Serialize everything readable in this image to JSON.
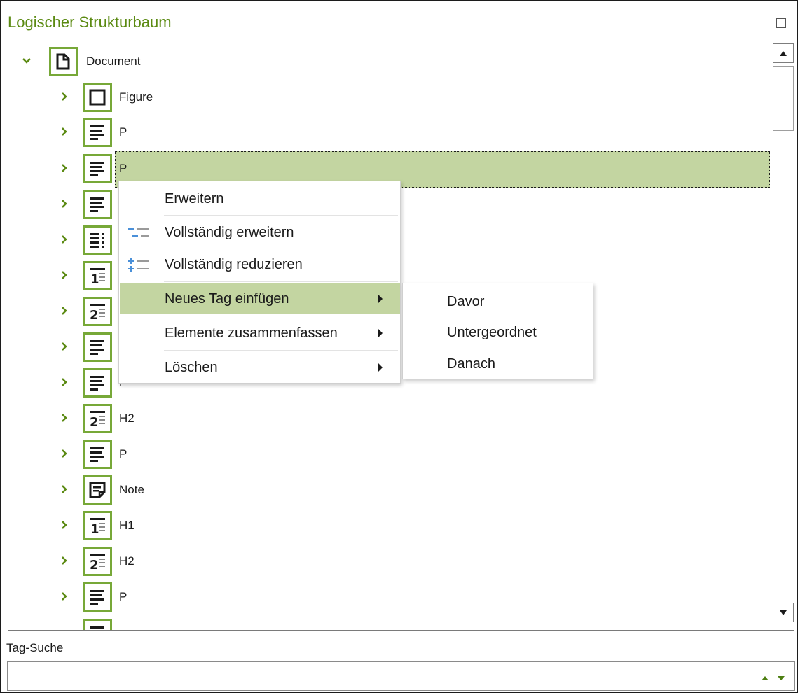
{
  "panel": {
    "title": "Logischer Strukturbaum"
  },
  "tree": {
    "root": {
      "label": "Document",
      "icon": "document-icon"
    },
    "rows": [
      {
        "label": "Figure",
        "icon": "figure-icon"
      },
      {
        "label": "P",
        "icon": "paragraph-icon"
      },
      {
        "label": "P",
        "icon": "paragraph-icon",
        "selected": true
      },
      {
        "label": "",
        "icon": "paragraph-icon"
      },
      {
        "label": "",
        "icon": "list-icon"
      },
      {
        "label": "",
        "icon": "heading-1-icon"
      },
      {
        "label": "",
        "icon": "heading-2-icon"
      },
      {
        "label": "",
        "icon": "paragraph-icon"
      },
      {
        "label": "P",
        "icon": "paragraph-icon"
      },
      {
        "label": "H2",
        "icon": "heading-2-icon"
      },
      {
        "label": "P",
        "icon": "paragraph-icon"
      },
      {
        "label": "Note",
        "icon": "note-icon"
      },
      {
        "label": "H1",
        "icon": "heading-1-icon"
      },
      {
        "label": "H2",
        "icon": "heading-2-icon"
      },
      {
        "label": "P",
        "icon": "paragraph-icon"
      },
      {
        "label": "",
        "icon": "paragraph-icon"
      }
    ]
  },
  "context_menu": {
    "items": [
      {
        "label": "Erweitern"
      },
      {
        "label": "Vollständig erweitern",
        "icon": "expand-all-icon"
      },
      {
        "label": "Vollständig reduzieren",
        "icon": "collapse-all-icon"
      },
      {
        "label": "Neues Tag einfügen",
        "submenu": true,
        "highlighted": true
      },
      {
        "label": "Elemente zusammenfassen",
        "submenu": true
      },
      {
        "label": "Löschen",
        "submenu": true
      }
    ]
  },
  "submenu": {
    "items": [
      {
        "label": "Davor"
      },
      {
        "label": "Untergeordnet"
      },
      {
        "label": "Danach"
      }
    ]
  },
  "search": {
    "label": "Tag-Suche",
    "value": "",
    "placeholder": ""
  },
  "colors": {
    "accent": "#5b8a12",
    "icon_border": "#77a838",
    "selection": "#c3d5a1"
  }
}
